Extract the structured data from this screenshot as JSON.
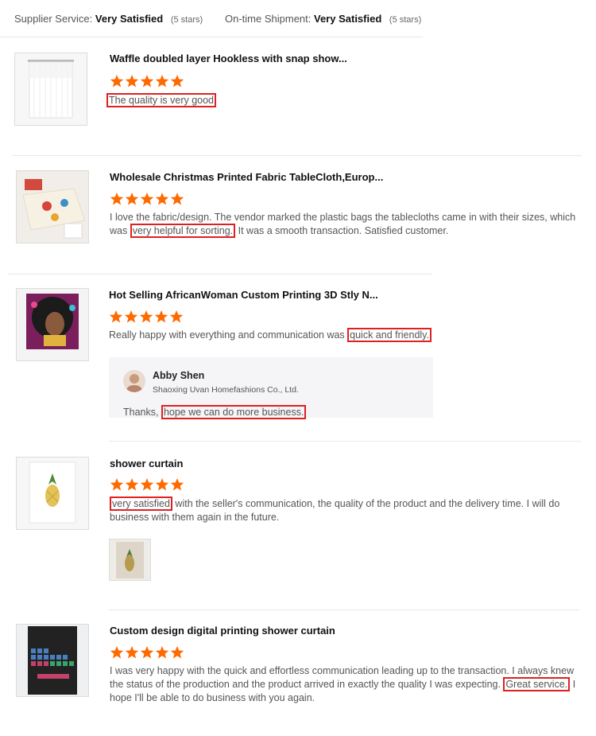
{
  "summary": {
    "supplier_label": "Supplier Service:",
    "supplier_value": "Very Satisfied",
    "supplier_stars": "(5 stars)",
    "shipment_label": "On-time Shipment:",
    "shipment_value": "Very Satisfied",
    "shipment_stars": "(5 stars)"
  },
  "star_color": "#ff6a00",
  "highlight_color": "#e02020",
  "reviews": [
    {
      "title": "Waffle doubled layer Hookless with snap show...",
      "rating": 5,
      "text_hl": "The quality is very good",
      "thumb_icon": "white-curtain-thumbnail"
    },
    {
      "title": "Wholesale Christmas Printed Fabric TableCloth,Europ...",
      "rating": 5,
      "text_pre": "I love the fabric/design.  The vendor marked the plastic bags the tablecloths came in with their sizes, which was ",
      "text_hl": "very helpful for sorting.",
      "text_post": " It was a smooth transaction.  Satisfied customer.",
      "thumb_icon": "tablecloth-thumbnail"
    },
    {
      "title": "Hot Selling AfricanWoman Custom Printing 3D Stly N...",
      "rating": 5,
      "text_pre": "Really happy with everything and communication was ",
      "text_hl": "quick and friendly.",
      "thumb_icon": "african-woman-curtain-thumbnail",
      "reply": {
        "name": "Abby Shen",
        "company": "Shaoxing Uvan Homefashions Co., Ltd.",
        "msg_pre": "Thanks, ",
        "msg_hl": "hope we can do more business."
      }
    },
    {
      "title": "shower curtain",
      "rating": 5,
      "text_hl": "very satisfied",
      "text_post": " with the seller's communication, the quality of the product and the delivery time. I will do business with them again in the future.",
      "thumb_icon": "pineapple-curtain-thumbnail",
      "attachment_icon": "review-photo-thumbnail"
    },
    {
      "title": "Custom design digital printing shower curtain",
      "rating": 5,
      "text_pre": "I was very happy with the quick and effortless communication leading up to the transaction. I always knew the status of the production and the product arrived in exactly the quality I was expecting. ",
      "text_hl": "Great service.",
      "text_post": " I hope I'll be able to do business with you again.",
      "thumb_icon": "periodic-table-curtain-thumbnail"
    }
  ]
}
